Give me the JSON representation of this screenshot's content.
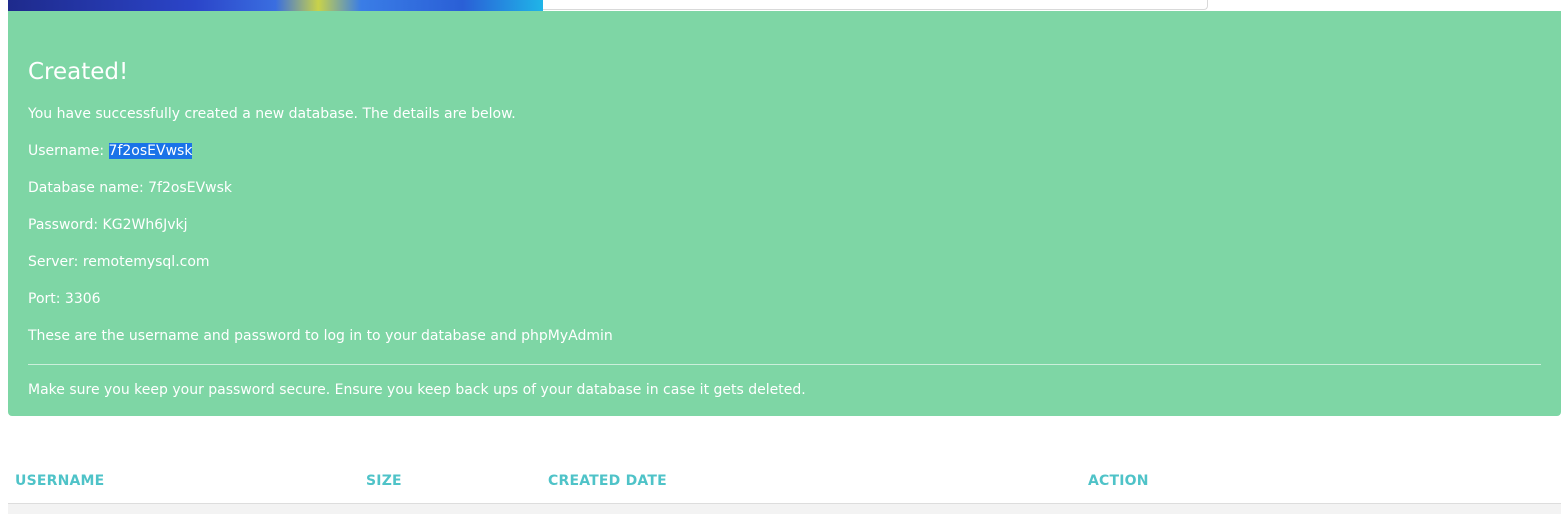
{
  "alert": {
    "title": "Created!",
    "intro": "You have successfully created a new database. The details are below.",
    "username_label": "Username: ",
    "username_value": "7f2osEVwsk",
    "database_name": "Database name: 7f2osEVwsk",
    "password": "Password: KG2Wh6Jvkj",
    "server": "Server: remotemysql.com",
    "port": "Port: 3306",
    "login_note": "These are the username and password to log in to your database and phpMyAdmin",
    "keep_note": "Make sure you keep your password secure. Ensure you keep back ups of your database in case it gets deleted."
  },
  "table": {
    "columns": [
      "USERNAME",
      "SIZE",
      "CREATED DATE",
      "ACTION"
    ]
  },
  "colors": {
    "alert_background": "#7ed6a5",
    "header_text": "#4fc3c8",
    "selection": "#1a73e8"
  }
}
